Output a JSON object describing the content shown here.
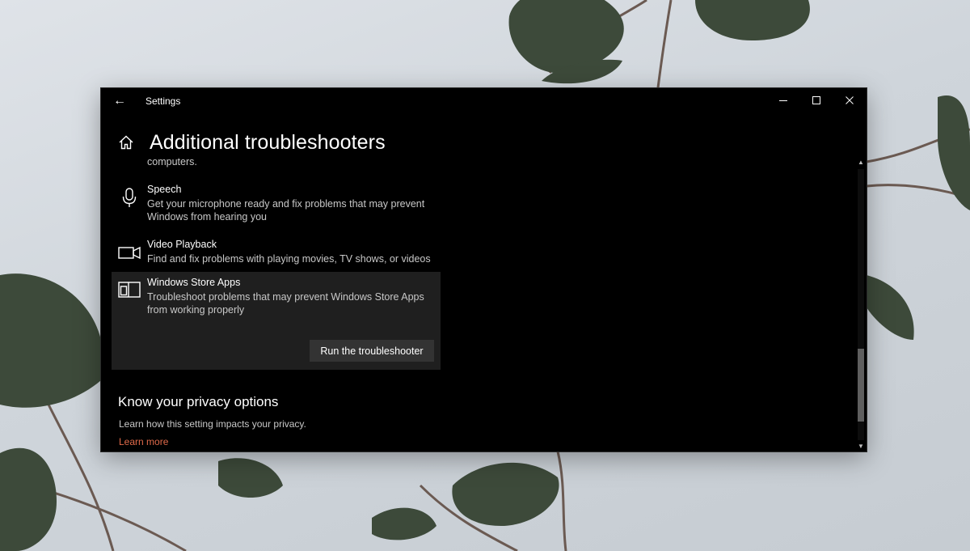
{
  "window": {
    "title": "Settings",
    "back_glyph": "←",
    "controls": [
      "minimize",
      "maximize",
      "close"
    ]
  },
  "header": {
    "title": "Additional troubleshooters",
    "icon": "home-icon"
  },
  "content": {
    "cut_text": "computers.",
    "items": [
      {
        "icon": "microphone-icon",
        "name": "Speech",
        "description": "Get your microphone ready and fix problems that may prevent Windows from hearing you"
      },
      {
        "icon": "video-camera-icon",
        "name": "Video Playback",
        "description": "Find and fix problems with playing movies, TV shows, or videos"
      },
      {
        "icon": "store-apps-icon",
        "name": "Windows Store Apps",
        "description": "Troubleshoot problems that may prevent Windows Store Apps from working properly",
        "selected": true,
        "button_label": "Run the troubleshooter"
      }
    ]
  },
  "privacy": {
    "title": "Know your privacy options",
    "description": "Learn how this setting impacts your privacy.",
    "link": "Learn more"
  },
  "colors": {
    "window_bg": "#000000",
    "selected_bg": "#1f1f1f",
    "button_bg": "#333333",
    "link": "#e06a4a",
    "secondary_text": "#c8c8c8"
  }
}
